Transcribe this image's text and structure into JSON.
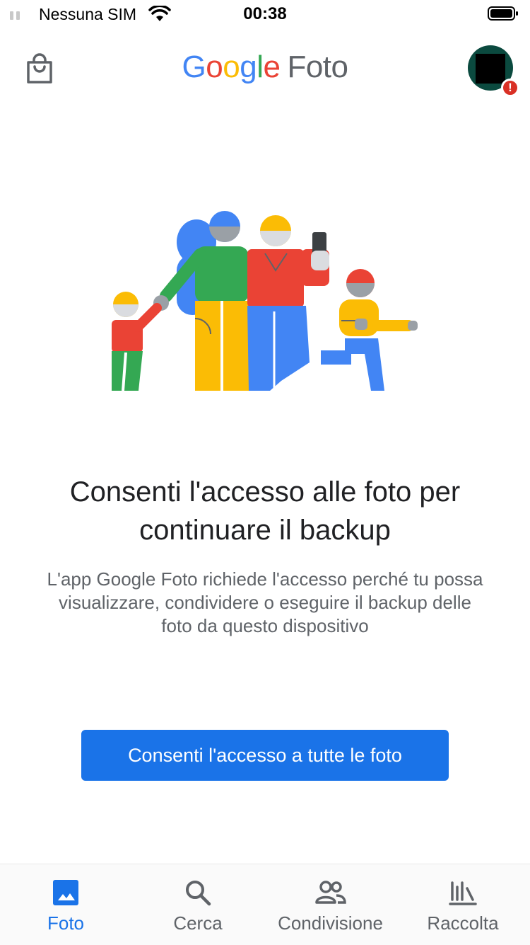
{
  "status_bar": {
    "carrier": "Nessuna SIM",
    "time": "00:38"
  },
  "header": {
    "logo_word": [
      "G",
      "o",
      "o",
      "g",
      "l",
      "e"
    ],
    "logo_suffix": "Foto"
  },
  "main": {
    "headline": "Consenti l'accesso alle foto per continuare il backup",
    "body": "L'app Google Foto richiede l'accesso perché tu possa visualizzare, condividere o eseguire il backup delle foto da questo dispositivo",
    "cta_label": "Consenti l'accesso a tutte le foto"
  },
  "alert_badge": "!",
  "bottom_nav": {
    "items": [
      {
        "label": "Foto",
        "icon": "photo-icon",
        "active": true
      },
      {
        "label": "Cerca",
        "icon": "search-icon",
        "active": false
      },
      {
        "label": "Condivisione",
        "icon": "people-icon",
        "active": false
      },
      {
        "label": "Raccolta",
        "icon": "library-icon",
        "active": false
      }
    ]
  },
  "colors": {
    "accent": "#1a73e8",
    "google_blue": "#4285F4",
    "google_red": "#EA4335",
    "google_yellow": "#FBBC05",
    "google_green": "#34A853",
    "avatar_bg": "#0b4a3f",
    "alert": "#d93025"
  }
}
